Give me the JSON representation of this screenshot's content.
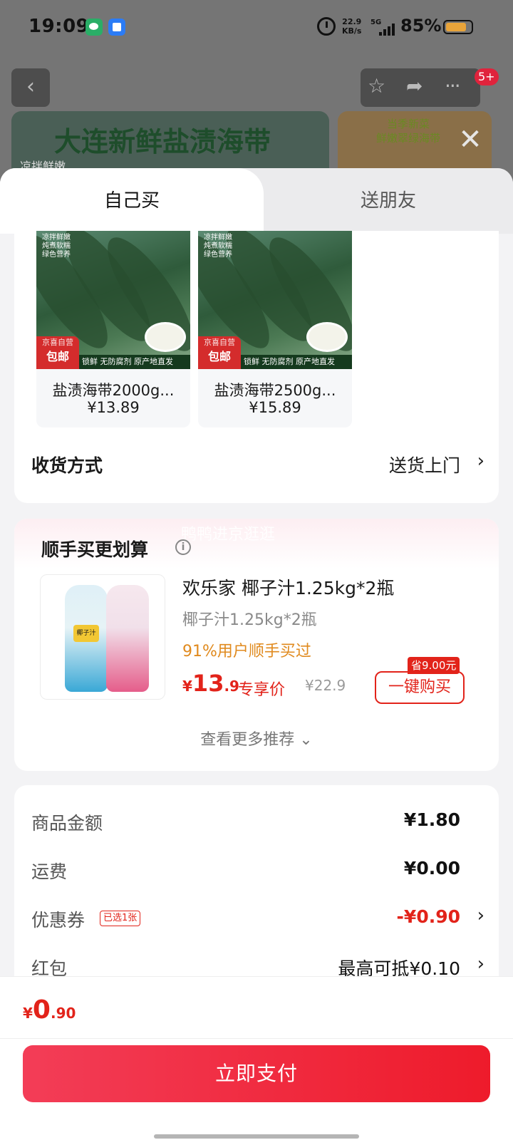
{
  "status_bar": {
    "time": "19:09",
    "net_speed_value": "22.9",
    "net_speed_unit": "KB/s",
    "network": "5G",
    "battery": "85%"
  },
  "background": {
    "badge": "5+",
    "banner_title": "大连新鲜盐渍海带",
    "banner_sub": "凉拌鲜嫩",
    "side_banner_text": "当季新菜\n鲜嫩翠绿海带"
  },
  "tabs": [
    {
      "label": "自己买"
    },
    {
      "label": "送朋友"
    }
  ],
  "products": [
    {
      "name": "盐渍海带2000g...",
      "price": "¥13.89",
      "badge_small": "京喜自营",
      "badge_big": "包邮",
      "strip": "锁鲜 无防腐剂 原产地直发",
      "img_text": "凉拌鲜嫩\n炖煮软糯\n绿色营养"
    },
    {
      "name": "盐渍海带2500g...",
      "price": "¥15.89",
      "badge_small": "京喜自营",
      "badge_big": "包邮",
      "strip": "锁鲜 无防腐剂 原产地直发",
      "img_text": "凉拌鲜嫩\n炖煮软糯\n绿色营养"
    }
  ],
  "delivery": {
    "label": "收货方式",
    "value": "送货上门"
  },
  "recommend": {
    "watermark": "鸭鸭进京逛逛",
    "title": "顺手买更划算",
    "name": "欢乐家 椰子汁1.25kg*2瓶",
    "spec": "椰子汁1.25kg*2瓶",
    "social": "91%用户顺手买过",
    "price_symbol": "¥",
    "price_int": "13",
    "price_dec": ".9",
    "price_tag": "专享价",
    "orig_price": "¥22.9",
    "save_badge": "省9.00元",
    "buy_label": "一键购买",
    "bottle_label": "椰子汁",
    "more": "查看更多推荐"
  },
  "summary": {
    "goods_label": "商品金额",
    "goods_value": "¥1.80",
    "shipping_label": "运费",
    "shipping_value": "¥0.00",
    "coupon_label": "优惠券",
    "coupon_badge": "已选1张",
    "coupon_value": "-¥0.90",
    "redpacket_label": "红包",
    "redpacket_value": "最高可抵¥0.10"
  },
  "footer": {
    "total_symbol": "¥",
    "total_int": "0",
    "total_dec": ".90",
    "pay_label": "立即支付"
  },
  "colors": {
    "accent_red": "#e2231a",
    "pay_button": "#f33d57",
    "social_orange": "#e08a1e"
  }
}
